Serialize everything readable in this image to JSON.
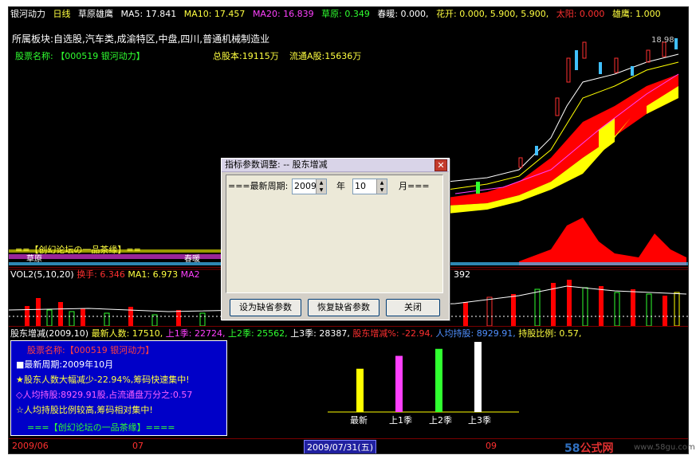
{
  "header": {
    "stock": "银河动力",
    "period": "日线",
    "indicator": "草原雄鹰",
    "ma5": "MA5: 17.841",
    "ma10": "MA10: 17.457",
    "ma20": "MA20: 16.839",
    "caoyuan": "草原: 0.349",
    "chunnuan": "春暖: 0.000,",
    "huakai": "花开: 0.000, 5.900, 5.900,",
    "taiyang": "太阳: 0.000",
    "xiongying": "雄鹰: 1.000"
  },
  "main": {
    "sector": "所属板块:自选股,汽车类,成渝特区,中盘,四川,普通机械制造业",
    "name": "股票名称: 【000519 银河动力】",
    "total_shares": "总股本:19115万",
    "float_shares": "流通A股:15636万",
    "price_label_high": "18.98",
    "bottom_tag": "==【创幻论坛の一品茶缘】==",
    "chunnuan_tag": "春暖",
    "caoyuan_tag": "草原"
  },
  "vol": {
    "label": "VOL2(5,10,20)",
    "turnover": "换手: 6.346",
    "ma1": "MA1: 6.973",
    "ma2": "MA2",
    "right_val": "392"
  },
  "holder": {
    "label": "股东增减(2009,10)",
    "latest": "最新人数: 17510,",
    "q1": "上1季: 22724,",
    "q2": "上2季: 25562,",
    "q3": "上3季: 28387,",
    "change": "股东增减%: -22.94,",
    "avg": "人均持股: 8929.91,",
    "ratio": "持股比例: 0.57,"
  },
  "bar_labels": [
    "最新",
    "上1季",
    "上2季",
    "上3季"
  ],
  "bar_colors": [
    "#ffff00",
    "#ff40ff",
    "#30ff30",
    "#ffffff"
  ],
  "bar_values": [
    17510,
    22724,
    25562,
    28387
  ],
  "info": {
    "name": "股票名称:【000519 银河动力】",
    "period": "■最新周期:2009年10月",
    "line1": "★股东人数大幅减少-22.94%,筹码快速集中!",
    "line2": "◇人均持股:8929.91股,占流通盘万分之:0.57",
    "line3": "☆人均持股比例较高,筹码相对集中!",
    "footer": "===【创幻论坛の一品茶缘】===="
  },
  "dates": {
    "d1": "2009/06",
    "d2": "07",
    "cursor": "2009/07/31(五)",
    "d3": "09"
  },
  "dialog": {
    "title": "指标参数调整: -- 股东增减",
    "close": "✕",
    "period_label": "===最新周期:",
    "year_value": "2009",
    "year_unit": "年",
    "month_value": "10",
    "month_unit": "月===",
    "btn_default": "设为缺省参数",
    "btn_restore": "恢复缺省参数",
    "btn_close": "关闭"
  },
  "watermark": {
    "brand_num": "58",
    "brand_text": "公式网",
    "url": "www.58gu.com"
  }
}
